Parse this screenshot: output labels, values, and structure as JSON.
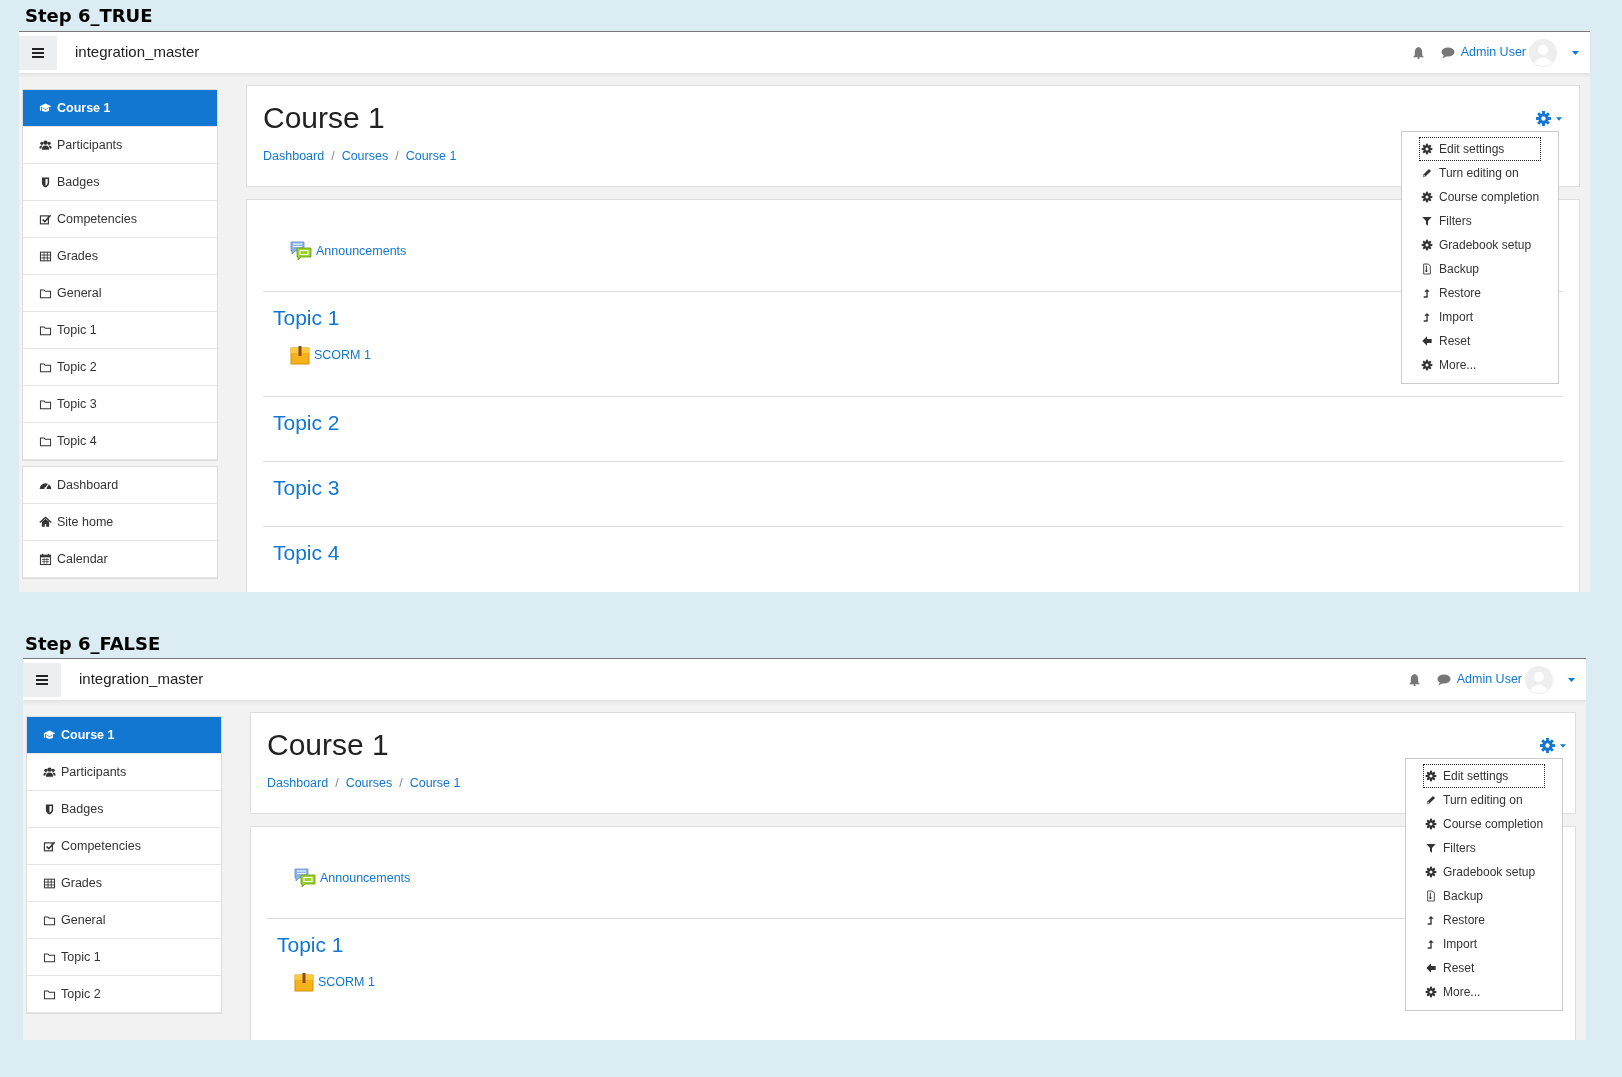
{
  "panels": [
    {
      "label": "Step 6_TRUE",
      "site_name": "integration_master",
      "user_name": "Admin User",
      "sidebar": [
        [
          {
            "label": "Course 1",
            "selected": true
          },
          {
            "label": "Participants",
            "selected": false
          },
          {
            "label": "Badges",
            "selected": false
          },
          {
            "label": "Competencies",
            "selected": false
          },
          {
            "label": "Grades",
            "selected": false
          },
          {
            "label": "General",
            "selected": false
          },
          {
            "label": "Topic 1",
            "selected": false
          },
          {
            "label": "Topic 2",
            "selected": false
          },
          {
            "label": "Topic 3",
            "selected": false
          },
          {
            "label": "Topic 4",
            "selected": false
          }
        ],
        [
          {
            "label": "Dashboard",
            "selected": false
          },
          {
            "label": "Site home",
            "selected": false
          },
          {
            "label": "Calendar",
            "selected": false
          }
        ]
      ],
      "course_title": "Course 1",
      "breadcrumbs": [
        "Dashboard",
        "Courses",
        "Course 1"
      ],
      "breadcrumb_separator": "/",
      "sections": [
        {
          "activities": [
            {
              "name": "Announcements",
              "kind": "forum"
            }
          ]
        },
        {
          "title": "Topic 1",
          "activities": [
            {
              "name": "SCORM 1",
              "kind": "scorm"
            }
          ]
        },
        {
          "title": "Topic 2"
        },
        {
          "title": "Topic 3"
        },
        {
          "title": "Topic 4"
        }
      ],
      "menu": [
        {
          "label": "Edit settings",
          "selected": true
        },
        {
          "label": "Turn editing on",
          "selected": false
        },
        {
          "label": "Course completion",
          "selected": false
        },
        {
          "label": "Filters",
          "selected": false
        },
        {
          "label": "Gradebook setup",
          "selected": false
        },
        {
          "label": "Backup",
          "selected": false
        },
        {
          "label": "Restore",
          "selected": false
        },
        {
          "label": "Import",
          "selected": false
        },
        {
          "label": "Reset",
          "selected": false
        },
        {
          "label": "More...",
          "selected": false
        }
      ]
    },
    {
      "label": "Step 6_FALSE",
      "site_name": "integration_master",
      "user_name": "Admin User",
      "sidebar": [
        [
          {
            "label": "Course 1",
            "selected": true
          },
          {
            "label": "Participants",
            "selected": false
          },
          {
            "label": "Badges",
            "selected": false
          },
          {
            "label": "Competencies",
            "selected": false
          },
          {
            "label": "Grades",
            "selected": false
          },
          {
            "label": "General",
            "selected": false
          },
          {
            "label": "Topic 1",
            "selected": false
          },
          {
            "label": "Topic 2",
            "selected": false
          }
        ]
      ],
      "course_title": "Course 1",
      "breadcrumbs": [
        "Dashboard",
        "Courses",
        "Course 1"
      ],
      "breadcrumb_separator": "/",
      "sections": [
        {
          "activities": [
            {
              "name": "Announcements",
              "kind": "forum"
            }
          ]
        },
        {
          "title": "Topic 1",
          "activities": [
            {
              "name": "SCORM 1",
              "kind": "scorm"
            }
          ]
        }
      ],
      "menu": [
        {
          "label": "Edit settings",
          "selected": true
        },
        {
          "label": "Turn editing on",
          "selected": false
        },
        {
          "label": "Course completion",
          "selected": false
        },
        {
          "label": "Filters",
          "selected": false
        },
        {
          "label": "Gradebook setup",
          "selected": false
        },
        {
          "label": "Backup",
          "selected": false
        },
        {
          "label": "Restore",
          "selected": false
        },
        {
          "label": "Import",
          "selected": false
        },
        {
          "label": "Reset",
          "selected": false
        },
        {
          "label": "More...",
          "selected": false
        }
      ]
    }
  ]
}
